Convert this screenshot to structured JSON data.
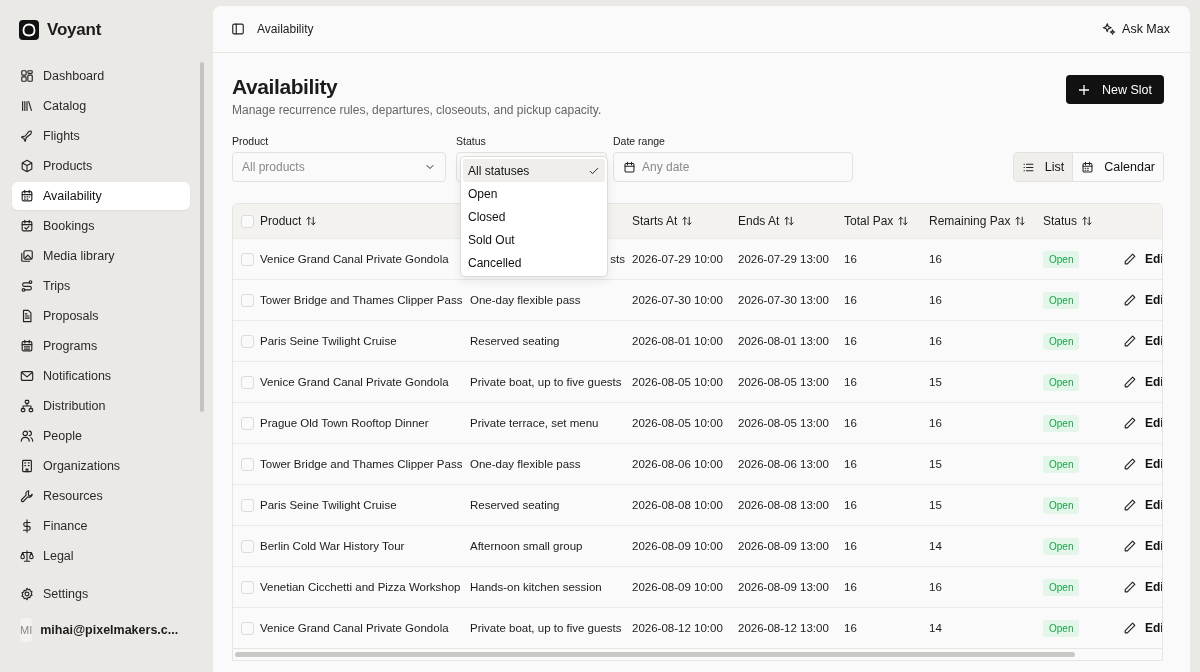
{
  "brand": {
    "name": "Voyant"
  },
  "sidebar": {
    "items": [
      {
        "label": "Dashboard",
        "selected": false
      },
      {
        "label": "Catalog",
        "selected": false
      },
      {
        "label": "Flights",
        "selected": false
      },
      {
        "label": "Products",
        "selected": false
      },
      {
        "label": "Availability",
        "selected": true
      },
      {
        "label": "Bookings",
        "selected": false
      },
      {
        "label": "Media library",
        "selected": false
      },
      {
        "label": "Trips",
        "selected": false
      },
      {
        "label": "Proposals",
        "selected": false
      },
      {
        "label": "Programs",
        "selected": false
      },
      {
        "label": "Notifications",
        "selected": false
      },
      {
        "label": "Distribution",
        "selected": false
      },
      {
        "label": "People",
        "selected": false
      },
      {
        "label": "Organizations",
        "selected": false
      },
      {
        "label": "Resources",
        "selected": false
      },
      {
        "label": "Finance",
        "selected": false
      },
      {
        "label": "Legal",
        "selected": false
      }
    ],
    "settings": "Settings",
    "user": {
      "initials": "MI",
      "email": "mihai@pixelmakers.c..."
    }
  },
  "topbar": {
    "breadcrumb": "Availability",
    "assistant": "Ask Max"
  },
  "page": {
    "title": "Availability",
    "subtitle": "Manage recurrence rules, departures, closeouts, and pickup capacity.",
    "new_button": "New Slot"
  },
  "filters": {
    "product": {
      "label": "Product",
      "placeholder": "All products"
    },
    "status": {
      "label": "Status",
      "open": true,
      "options": [
        {
          "label": "All statuses",
          "selected": true
        },
        {
          "label": "Open",
          "selected": false
        },
        {
          "label": "Closed",
          "selected": false
        },
        {
          "label": "Sold Out",
          "selected": false
        },
        {
          "label": "Cancelled",
          "selected": false
        }
      ]
    },
    "date": {
      "label": "Date range",
      "placeholder": "Any date"
    }
  },
  "views": [
    {
      "label": "List",
      "selected": true
    },
    {
      "label": "Calendar",
      "selected": false
    }
  ],
  "table": {
    "select_all_checked": false,
    "columns": [
      "Product",
      "",
      "Starts At",
      "Ends At",
      "Total Pax",
      "Remaining Pax",
      "Status"
    ],
    "rows": [
      {
        "checked": false,
        "product": "Venice Grand Canal Private Gondola",
        "option": "sts",
        "starts": "2026-07-29 10:00",
        "ends": "2026-07-29 13:00",
        "total": "16",
        "remaining": "16",
        "status": "Open",
        "action": "Edi"
      },
      {
        "checked": false,
        "product": "Tower Bridge and Thames Clipper Pass",
        "option": "One-day flexible pass",
        "starts": "2026-07-30 10:00",
        "ends": "2026-07-30 13:00",
        "total": "16",
        "remaining": "16",
        "status": "Open",
        "action": "Edi"
      },
      {
        "checked": false,
        "product": "Paris Seine Twilight Cruise",
        "option": "Reserved seating",
        "starts": "2026-08-01 10:00",
        "ends": "2026-08-01 13:00",
        "total": "16",
        "remaining": "16",
        "status": "Open",
        "action": "Edi"
      },
      {
        "checked": false,
        "product": "Venice Grand Canal Private Gondola",
        "option": "Private boat, up to five guests",
        "starts": "2026-08-05 10:00",
        "ends": "2026-08-05 13:00",
        "total": "16",
        "remaining": "15",
        "status": "Open",
        "action": "Edi"
      },
      {
        "checked": false,
        "product": "Prague Old Town Rooftop Dinner",
        "option": "Private terrace, set menu",
        "starts": "2026-08-05 10:00",
        "ends": "2026-08-05 13:00",
        "total": "16",
        "remaining": "16",
        "status": "Open",
        "action": "Edi"
      },
      {
        "checked": false,
        "product": "Tower Bridge and Thames Clipper Pass",
        "option": "One-day flexible pass",
        "starts": "2026-08-06 10:00",
        "ends": "2026-08-06 13:00",
        "total": "16",
        "remaining": "15",
        "status": "Open",
        "action": "Edi"
      },
      {
        "checked": false,
        "product": "Paris Seine Twilight Cruise",
        "option": "Reserved seating",
        "starts": "2026-08-08 10:00",
        "ends": "2026-08-08 13:00",
        "total": "16",
        "remaining": "15",
        "status": "Open",
        "action": "Edi"
      },
      {
        "checked": false,
        "product": "Berlin Cold War History Tour",
        "option": "Afternoon small group",
        "starts": "2026-08-09 10:00",
        "ends": "2026-08-09 13:00",
        "total": "16",
        "remaining": "14",
        "status": "Open",
        "action": "Edi"
      },
      {
        "checked": false,
        "product": "Venetian Cicchetti and Pizza Workshop",
        "option": "Hands-on kitchen session",
        "starts": "2026-08-09 10:00",
        "ends": "2026-08-09 13:00",
        "total": "16",
        "remaining": "16",
        "status": "Open",
        "action": "Edi"
      },
      {
        "checked": false,
        "product": "Venice Grand Canal Private Gondola",
        "option": "Private boat, up to five guests",
        "starts": "2026-08-12 10:00",
        "ends": "2026-08-12 13:00",
        "total": "16",
        "remaining": "14",
        "status": "Open",
        "action": "Edi"
      }
    ]
  }
}
